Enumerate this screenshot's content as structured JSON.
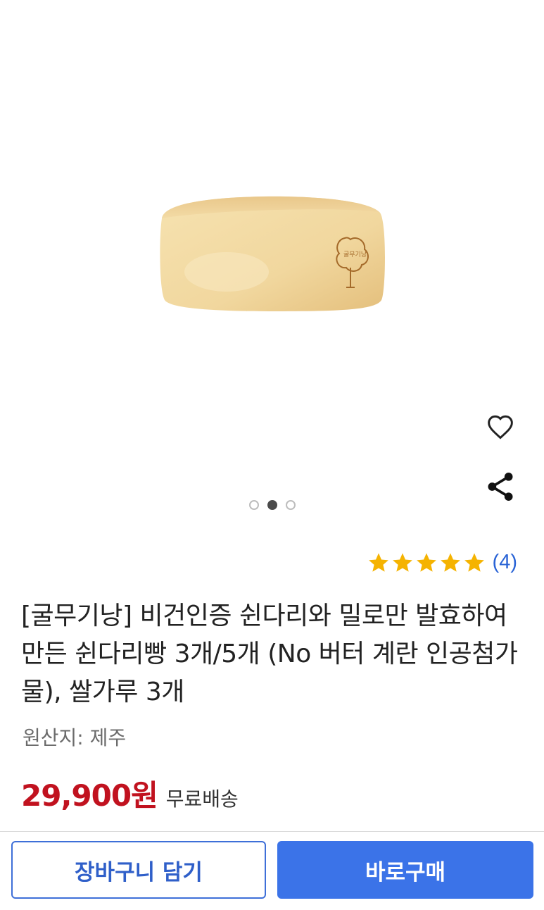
{
  "product_image": {
    "alt": "rice bread loaf"
  },
  "actions": {
    "wishlist_icon": "heart-outline-icon",
    "share_icon": "share-icon"
  },
  "carousel": {
    "total": 3,
    "active_index": 1
  },
  "rating": {
    "stars": 5,
    "count_text": "(4)",
    "star_color": "#f5b301"
  },
  "title": "[굴무기낭] 비건인증 쉰다리와 밀로만 발효하여 만든 쉰다리빵 3개/5개 (No 버터 계란 인공첨가물), 쌀가루 3개",
  "origin": "원산지: 제주",
  "price": {
    "amount": "29,900원",
    "shipping": "무료배송",
    "color": "#c1121f"
  },
  "buttons": {
    "cart": "장바구니 담기",
    "buy": "바로구매",
    "accent": "#3b73e8"
  }
}
